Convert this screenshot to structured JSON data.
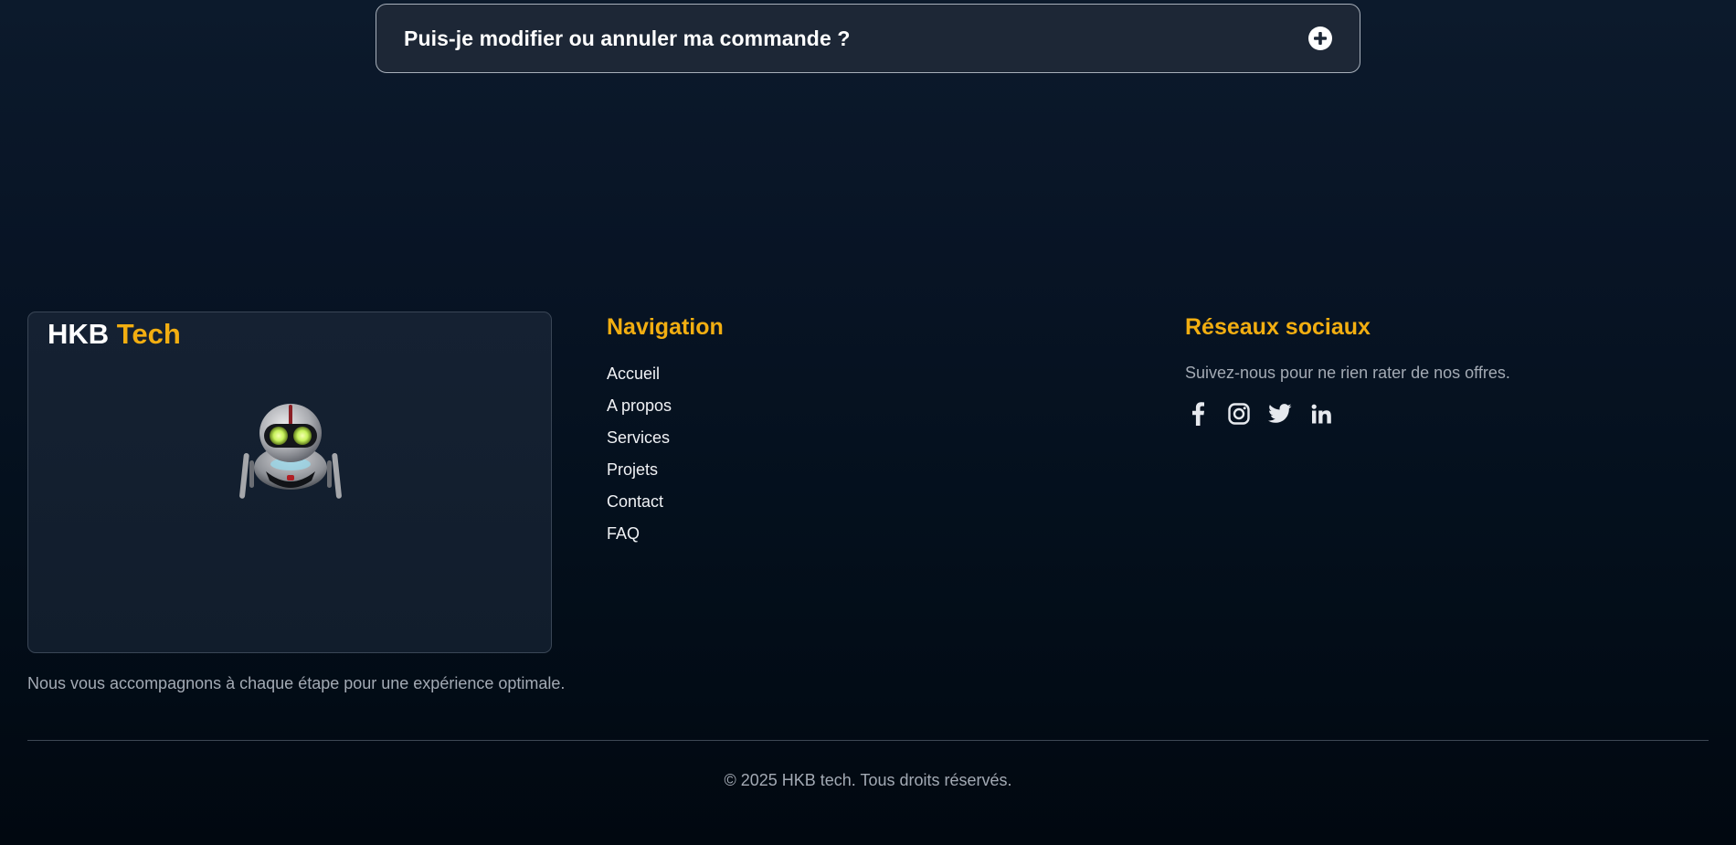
{
  "faq": {
    "question": "Puis-je modifier ou annuler ma commande ?",
    "toggle_icon": "plus-circle-icon"
  },
  "footer": {
    "brand": {
      "name_part1": "HKB",
      "name_part2": "Tech",
      "mascot_icon": "robot-icon",
      "tagline": "Nous vous accompagnons à chaque étape pour une expérience optimale."
    },
    "navigation": {
      "heading": "Navigation",
      "items": [
        {
          "label": "Accueil"
        },
        {
          "label": "A propos"
        },
        {
          "label": "Services"
        },
        {
          "label": "Projets"
        },
        {
          "label": "Contact"
        },
        {
          "label": "FAQ"
        }
      ]
    },
    "social": {
      "heading": "Réseaux sociaux",
      "text": "Suivez-nous pour ne rien rater de nos offres.",
      "icons": [
        "facebook-icon",
        "instagram-icon",
        "twitter-icon",
        "linkedin-icon"
      ]
    },
    "copyright": "© 2025 HKB tech. Tous droits réservés."
  },
  "colors": {
    "accent": "#f2ae11",
    "background": "#081425",
    "card": "#1d2736",
    "muted_text": "#a3aab4"
  }
}
